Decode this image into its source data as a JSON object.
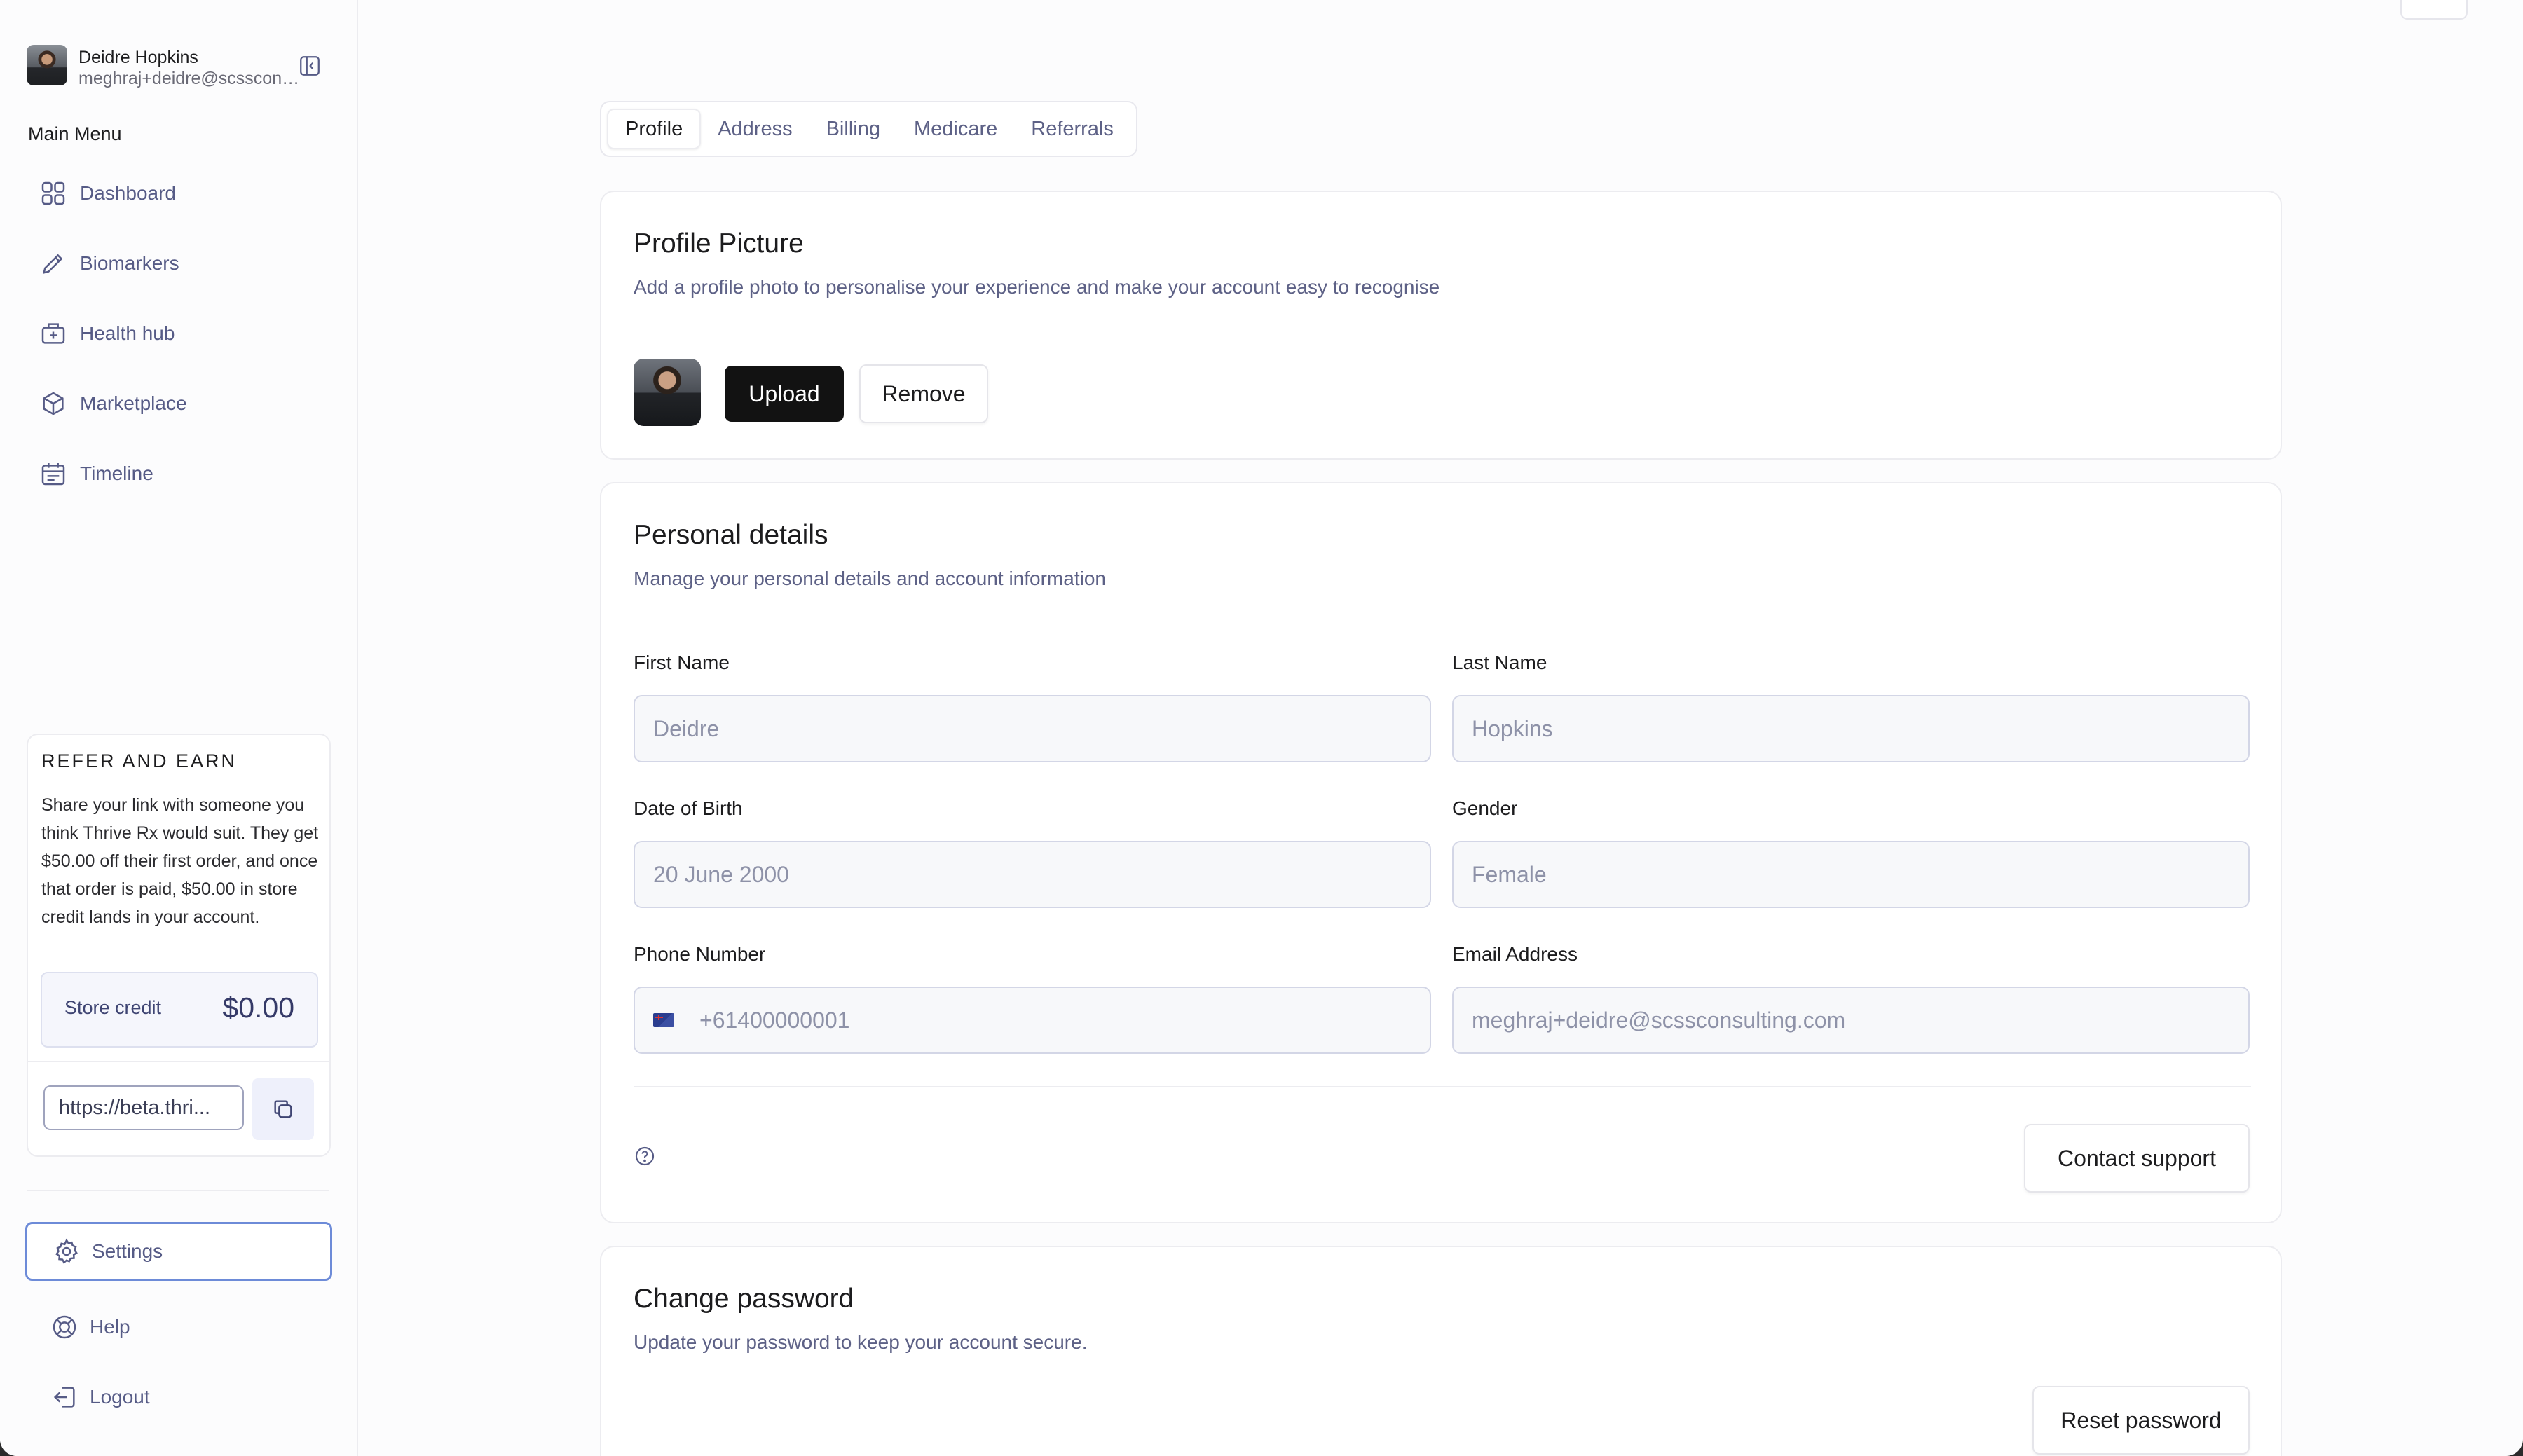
{
  "user": {
    "name": "Deidre Hopkins",
    "email": "meghraj+deidre@scssconsulting.com"
  },
  "sidebar": {
    "menu_heading": "Main Menu",
    "items": [
      {
        "label": "Dashboard",
        "icon": "grid-icon"
      },
      {
        "label": "Biomarkers",
        "icon": "pen-icon"
      },
      {
        "label": "Health hub",
        "icon": "medical-bag-icon"
      },
      {
        "label": "Marketplace",
        "icon": "box-icon"
      },
      {
        "label": "Timeline",
        "icon": "calendar-icon"
      }
    ],
    "refer": {
      "title": "REFER AND EARN",
      "text": "Share your link with someone you think Thrive Rx would suit. They get $50.00 off their first order, and once that order is paid, $50.00 in store credit lands in your account.",
      "credit_label": "Store credit",
      "credit_value": "$0.00",
      "link_value": "https://beta.thri..."
    },
    "bottom": [
      {
        "label": "Settings",
        "icon": "gear-icon",
        "active": true
      },
      {
        "label": "Help",
        "icon": "lifebuoy-icon"
      },
      {
        "label": "Logout",
        "icon": "logout-icon"
      }
    ]
  },
  "tabs": [
    "Profile",
    "Address",
    "Billing",
    "Medicare",
    "Referrals"
  ],
  "profile_picture": {
    "title": "Profile Picture",
    "subtitle": "Add a profile photo to personalise your experience and make your account easy to recognise",
    "upload_label": "Upload",
    "remove_label": "Remove"
  },
  "personal": {
    "title": "Personal details",
    "subtitle": "Manage your personal details and account information",
    "first_name_label": "First Name",
    "first_name": "Deidre",
    "last_name_label": "Last Name",
    "last_name": "Hopkins",
    "dob_label": "Date of Birth",
    "dob": "20 June 2000",
    "gender_label": "Gender",
    "gender": "Female",
    "phone_label": "Phone Number",
    "phone": "+61400000001",
    "email_label": "Email Address",
    "email": "meghraj+deidre@scssconsulting.com",
    "contact_label": "Contact support"
  },
  "password": {
    "title": "Change password",
    "subtitle": "Update your password to keep your account secure.",
    "reset_label": "Reset password"
  }
}
